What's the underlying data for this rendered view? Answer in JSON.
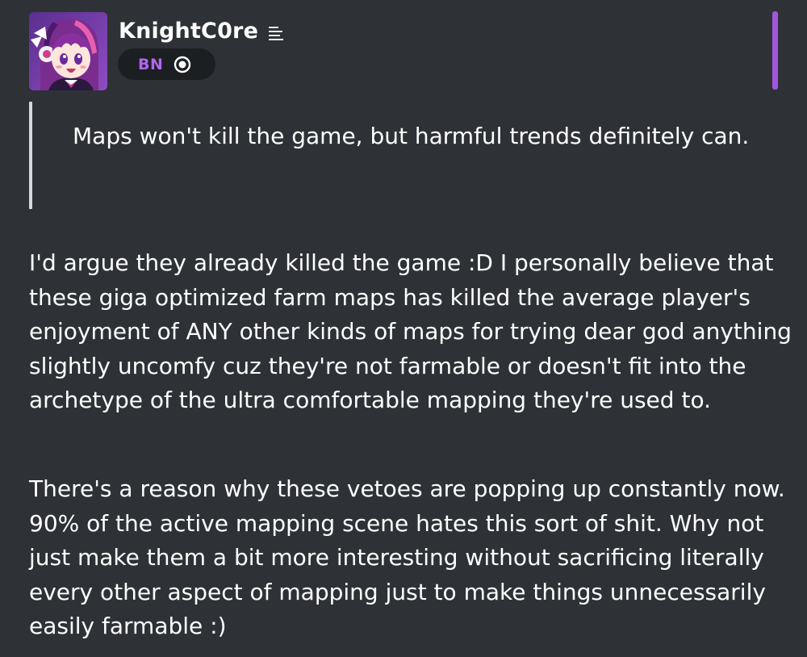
{
  "user": {
    "username": "KnightC0re",
    "group_badge": "BN",
    "avatar_icon": "anime-character-avatar",
    "menu_icon": "menu-icon",
    "badge_icon": "radio-circle-icon",
    "accent_color": "#a056e0"
  },
  "quote": {
    "text": "Maps won't kill the game, but harmful trends definitely can."
  },
  "body": {
    "paragraphs": [
      "I'd argue they already killed the game :D I personally believe that these giga optimized farm maps has killed the average player's enjoyment of ANY other kinds of maps for trying dear god anything slightly uncomfy cuz they're not farmable or doesn't fit into the archetype of the ultra comfortable mapping they're used to.",
      "There's a reason why these vetoes are popping up constantly now. 90% of the active mapping scene hates this sort of shit. Why not just make them a bit more interesting without sacrificing literally every other aspect of mapping just to make things unnecessarily easily farmable :)"
    ]
  }
}
